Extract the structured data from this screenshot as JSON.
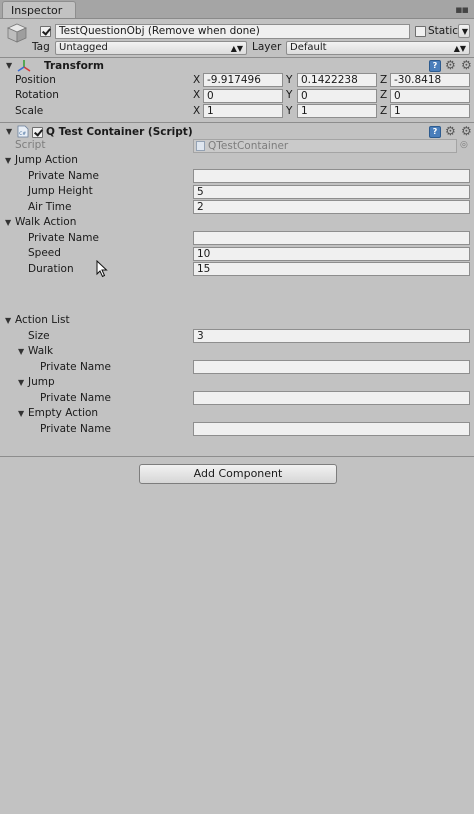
{
  "window": {
    "tab_label": "Inspector"
  },
  "header": {
    "active": true,
    "object_name": "TestQuestionObj (Remove when done)",
    "static_label": "Static",
    "tag_label": "Tag",
    "tag_value": "Untagged",
    "layer_label": "Layer",
    "layer_value": "Default"
  },
  "transform": {
    "title": "Transform",
    "rows": [
      {
        "label": "Position",
        "x": "-9.917496",
        "y": "0.1422238",
        "z": "-30.8418"
      },
      {
        "label": "Rotation",
        "x": "0",
        "y": "0",
        "z": "0"
      },
      {
        "label": "Scale",
        "x": "1",
        "y": "1",
        "z": "1"
      }
    ],
    "axis": {
      "x": "X",
      "y": "Y",
      "z": "Z"
    }
  },
  "script_component": {
    "enabled": true,
    "title": "Q Test Container (Script)",
    "script_label": "Script",
    "script_value": "QTestContainer",
    "jump_action": {
      "label": "Jump Action",
      "private_name_label": "Private Name",
      "private_name_value": "",
      "jump_height_label": "Jump Height",
      "jump_height_value": "5",
      "air_time_label": "Air Time",
      "air_time_value": "2"
    },
    "walk_action": {
      "label": "Walk Action",
      "private_name_label": "Private Name",
      "private_name_value": "",
      "speed_label": "Speed",
      "speed_value": "10",
      "duration_label": "Duration",
      "duration_value": "15"
    },
    "action_list": {
      "label": "Action List",
      "size_label": "Size",
      "size_value": "3",
      "items": [
        {
          "label": "Walk",
          "private_name_label": "Private Name",
          "private_name_value": ""
        },
        {
          "label": "Jump",
          "private_name_label": "Private Name",
          "private_name_value": ""
        },
        {
          "label": "Empty Action",
          "private_name_label": "Private Name",
          "private_name_value": ""
        }
      ]
    }
  },
  "add_component_label": "Add Component",
  "icons": {
    "cube": "gameobject-cube-icon",
    "transform": "transform-axes-icon",
    "script": "script-file-icon",
    "help": "help-book-icon",
    "settings": "gear-icon",
    "menu": "context-menu-icon"
  }
}
